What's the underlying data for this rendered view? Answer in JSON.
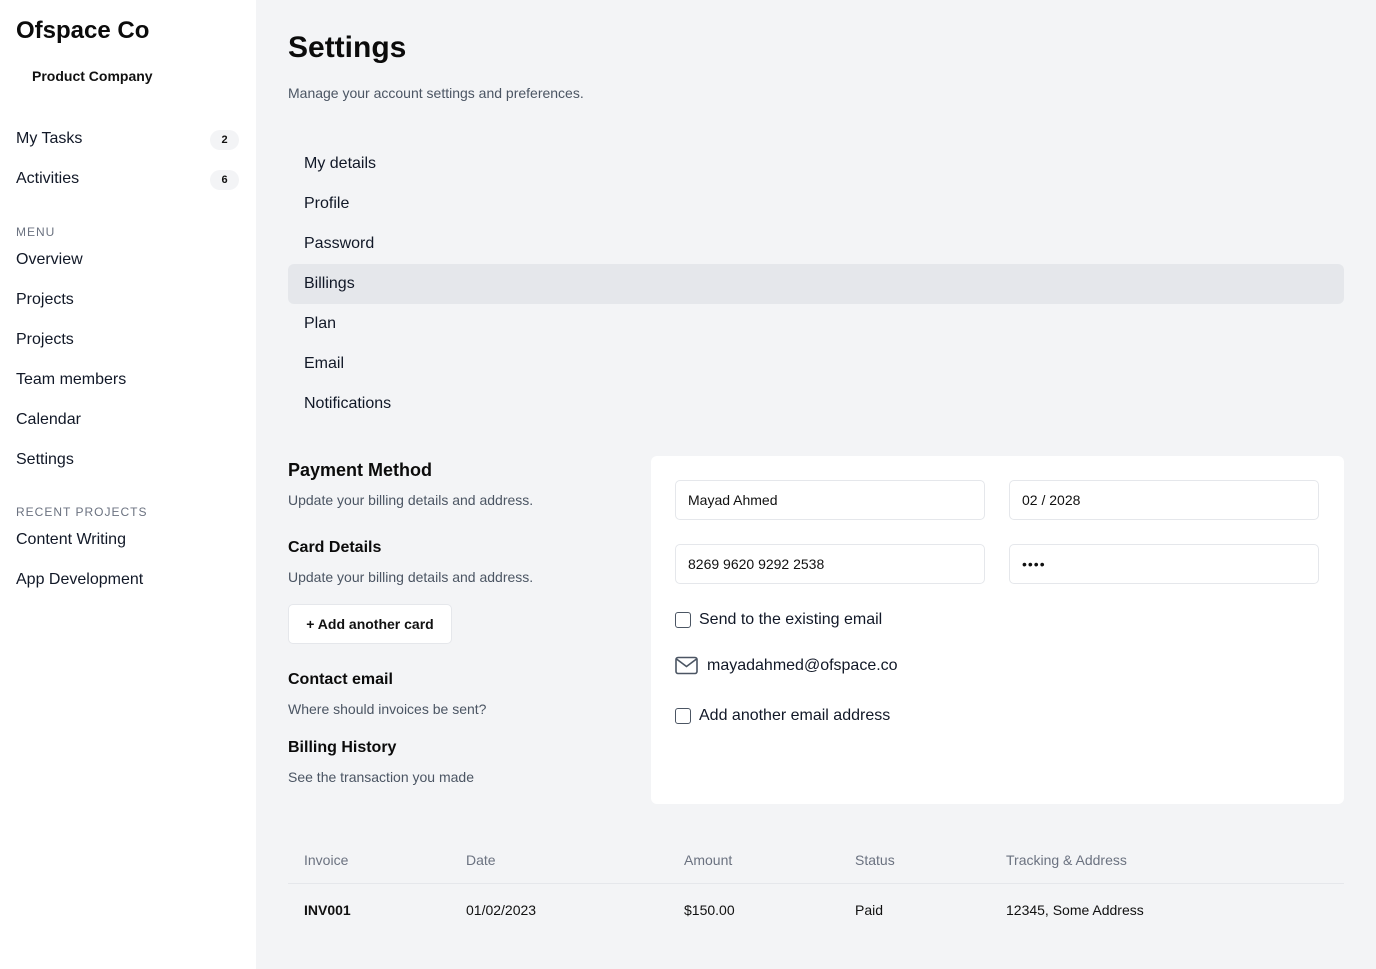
{
  "sidebar": {
    "brand": "Ofspace Co",
    "company": "Product Company",
    "quick": [
      {
        "label": "My Tasks",
        "count": "2"
      },
      {
        "label": "Activities",
        "count": "6"
      }
    ],
    "menu_label": "MENU",
    "menu": [
      "Overview",
      "Projects",
      "Projects",
      "Team members",
      "Calendar",
      "Settings"
    ],
    "recent_label": "RECENT PROJECTS",
    "recent": [
      "Content Writing",
      "App Development"
    ]
  },
  "header": {
    "title": "Settings",
    "subtitle": "Manage your account settings and preferences."
  },
  "tabs": [
    "My details",
    "Profile",
    "Password",
    "Billings",
    "Plan",
    "Email",
    "Notifications"
  ],
  "active_tab": "Billings",
  "billing": {
    "payment_title": "Payment Method",
    "payment_desc": "Update your billing details and address.",
    "card_title": "Card Details",
    "card_desc": "Update your billing details and address.",
    "add_card_label": "+ Add another card",
    "contact_title": "Contact email",
    "contact_desc": "Where should invoices be sent?",
    "history_title": "Billing History",
    "history_desc": "See the transaction you made"
  },
  "form": {
    "name": "Mayad Ahmed",
    "expiry": "02 / 2028",
    "card_number": "8269 9620 9292 2538",
    "cvv": "••••",
    "send_existing_label": "Send to the existing email",
    "existing_email": "mayadahmed@ofspace.co",
    "add_email_label": "Add another email address"
  },
  "table": {
    "headers": [
      "Invoice",
      "Date",
      "Amount",
      "Status",
      "Tracking & Address"
    ],
    "rows": [
      [
        "INV001",
        "01/02/2023",
        "$150.00",
        "Paid",
        "12345, Some Address"
      ]
    ]
  }
}
